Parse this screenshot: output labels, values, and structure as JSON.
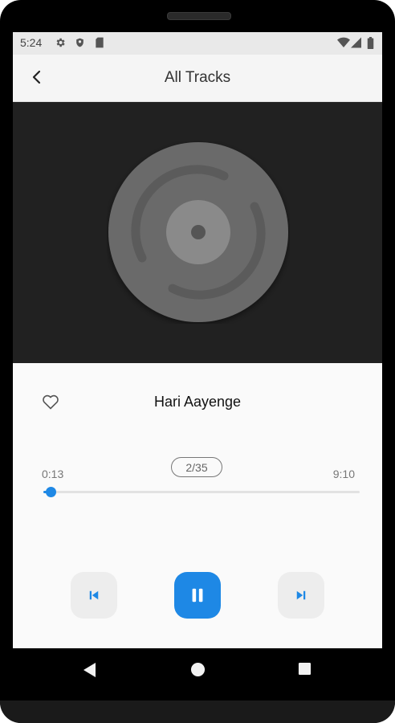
{
  "status_bar": {
    "time": "5:24",
    "icons": [
      "settings-icon",
      "shield-icon",
      "sim-card-icon",
      "wifi-icon",
      "signal-icon",
      "battery-icon"
    ]
  },
  "app_bar": {
    "title": "All Tracks",
    "back_icon": "arrow-back-icon"
  },
  "album_art": {
    "icon": "disc-placeholder-icon"
  },
  "player": {
    "track_title": "Hari Aayenge",
    "favorite_icon": "heart-outline-icon",
    "track_counter": "2/35",
    "elapsed_time": "0:13",
    "total_time": "9:10",
    "progress_fraction": 0.024,
    "controls": {
      "previous_icon": "skip-previous-icon",
      "play_pause_icon": "pause-icon",
      "next_icon": "skip-next-icon"
    }
  },
  "navigation_bar": {
    "icons": [
      "back-triangle-icon",
      "home-circle-icon",
      "recents-square-icon"
    ]
  },
  "colors": {
    "accent": "#1e88e5",
    "art_background": "#212121",
    "disc": "#6b6b6b"
  }
}
